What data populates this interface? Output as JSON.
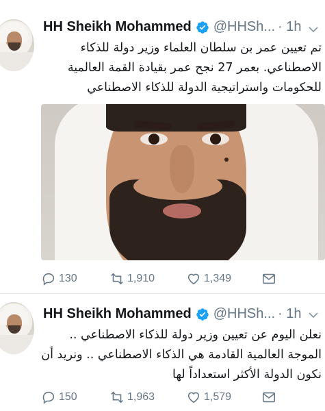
{
  "tweets": [
    {
      "name": "HH Sheikh Mohammed",
      "handle": "@HHSh...",
      "time": "· 1h",
      "text_lines": [
        "تم تعيين عمر بن سلطان العلماء وزير دولة للذكاء",
        "الاصطناعي. بعمر 27 نجح عمر بقيادة القمة العالمية",
        "للحكومات واستراتيجية الدولة للذكاء الاصطناعي"
      ],
      "replies": "130",
      "retweets": "1,910",
      "likes": "1,349"
    },
    {
      "name": "HH Sheikh Mohammed",
      "handle": "@HHSh...",
      "time": "· 1h",
      "text_lines": [
        "نعلن اليوم عن تعيين وزير دولة للذكاء الاصطناعي ..",
        "الموجة العالمية القادمة هي الذكاء الاصطناعي .. ونريد أن",
        "نكون الدولة الأكثر استعداداً لها"
      ],
      "replies": "150",
      "retweets": "1,963",
      "likes": "1,579"
    }
  ],
  "colors": {
    "verified": "#1da1f2",
    "secondary_text": "#657786",
    "primary_text": "#14171a"
  },
  "icons": [
    "reply-icon",
    "retweet-icon",
    "like-icon",
    "direct-message-icon",
    "verified-badge-icon",
    "chevron-down-icon"
  ]
}
